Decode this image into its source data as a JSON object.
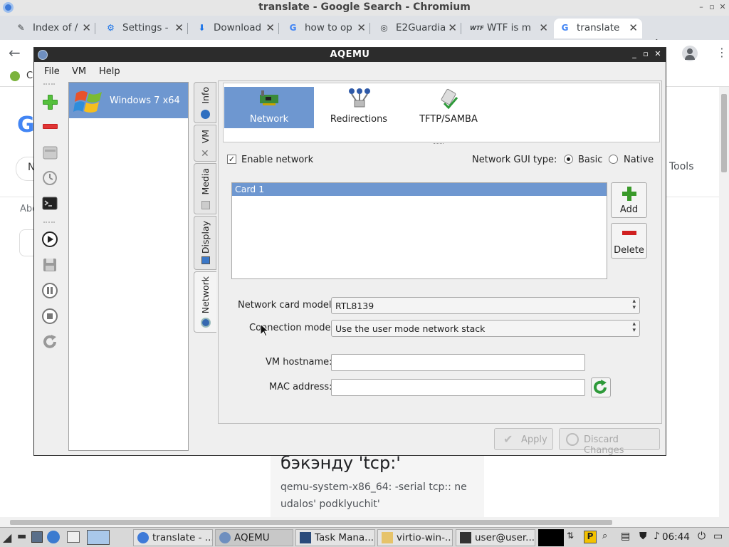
{
  "chrome": {
    "title": "translate - Google Search - Chromium",
    "tabs": [
      {
        "label": "Index of /",
        "icon": "page-icon"
      },
      {
        "label": "Settings -",
        "icon": "gear-icon"
      },
      {
        "label": "Download",
        "icon": "download-icon"
      },
      {
        "label": "how to op",
        "icon": "google-icon"
      },
      {
        "label": "E2Guardia",
        "icon": "e2guardian-icon"
      },
      {
        "label": "WTF is m",
        "icon": "wtf-icon"
      },
      {
        "label": "translate",
        "icon": "google-icon"
      }
    ],
    "bookmark_initial": "C",
    "new_tab": "+",
    "tab_menu": "⌄"
  },
  "page_fragments": {
    "tools": "Tools",
    "abo": "Abo",
    "n": "N",
    "result_heading": "бэкэнду 'tcp:'",
    "result_line1": "qemu-system-x86_64: -serial tcp:: ne",
    "result_line2": "udalos' podklyuchit'"
  },
  "aqemu": {
    "title": "AQEMU",
    "menu": [
      "File",
      "VM",
      "Help"
    ],
    "vm_list": [
      {
        "name": "Windows 7 x64"
      }
    ],
    "side_tabs": [
      "Info",
      "VM",
      "Media",
      "Display",
      "Network"
    ],
    "subtabs": [
      "Network",
      "Redirections",
      "TFTP/SAMBA"
    ],
    "enable_network": "Enable network",
    "enable_network_checked": true,
    "gui_type_label": "Network GUI type:",
    "gui_basic": "Basic",
    "gui_native": "Native",
    "gui_selected": "Basic",
    "cards": [
      "Card 1"
    ],
    "add_label": "Add",
    "delete_label": "Delete",
    "card_model_label": "Network card model:",
    "card_model_value": "RTL8139",
    "conn_mode_label": "Connection mode:",
    "conn_mode_value": "Use the user mode network stack",
    "hostname_label": "VM hostname:",
    "hostname_value": "",
    "mac_label": "MAC address:",
    "mac_value": "",
    "apply_label": "Apply",
    "discard_label": "Discard Changes"
  },
  "taskbar": {
    "buttons": [
      "translate - ...",
      "AQEMU",
      "Task Mana...",
      "virtio-win-...",
      "user@user..."
    ],
    "clock": "06:44"
  },
  "colors": {
    "selection": "#6e97d0",
    "aqemu_titlebar": "#2c2c2c"
  }
}
